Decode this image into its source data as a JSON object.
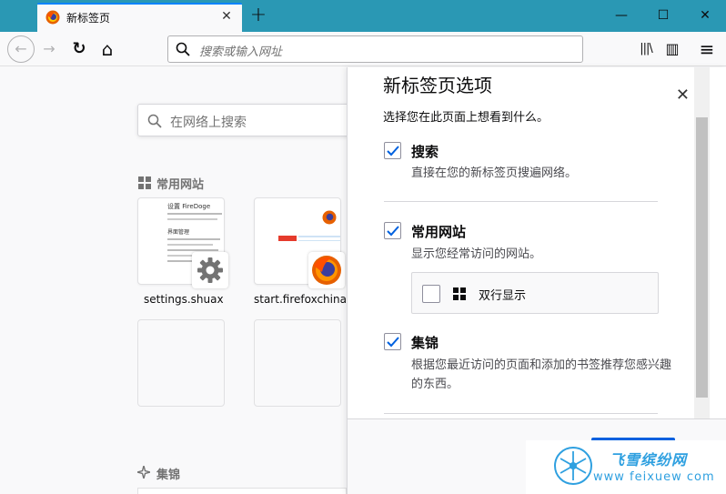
{
  "browser": {
    "tab": {
      "title": "新标签页",
      "close": "✕"
    },
    "new_tab": "+",
    "window": {
      "minimize": "—",
      "maximize": "☐",
      "close": "✕"
    },
    "nav": {
      "back": "←",
      "forward": "→",
      "reload": "↻",
      "home": "⌂"
    },
    "urlbar": {
      "placeholder": "搜索或输入网址"
    },
    "toolbar": {
      "library": "|||\\",
      "sidebar": "▥",
      "menu": "≡"
    }
  },
  "newtab": {
    "search_placeholder": "在网络上搜索",
    "topsites_title": "常用网站",
    "highlights_title": "集锦",
    "tiles": [
      {
        "label": "settings.shuax",
        "thumb_header": "设置 FireDoge",
        "thumb_sub": "界面管理"
      },
      {
        "label": "start.firefoxchina"
      }
    ]
  },
  "prefs": {
    "title": "新标签页选项",
    "close": "✕",
    "subtitle": "选择您在此页面上想看到什么。",
    "sections": [
      {
        "label": "搜索",
        "desc": "直接在您的新标签页搜遍网络。",
        "checked": true
      },
      {
        "label": "常用网站",
        "desc": "显示您经常访问的网站。",
        "checked": true
      },
      {
        "label": "集锦",
        "desc": "根据您最近访问的页面和添加的书签推荐您感兴趣的东西。",
        "checked": true
      }
    ],
    "sub_option": {
      "label": "双行显示",
      "checked": false
    }
  },
  "watermark": {
    "title": "飞雪缤纷网",
    "url": "www feixuew com"
  },
  "colors": {
    "titlebar": "#2a98b4",
    "accent": "#0a84ff",
    "button": "#0060df",
    "watermark": "#2fa0e0"
  }
}
